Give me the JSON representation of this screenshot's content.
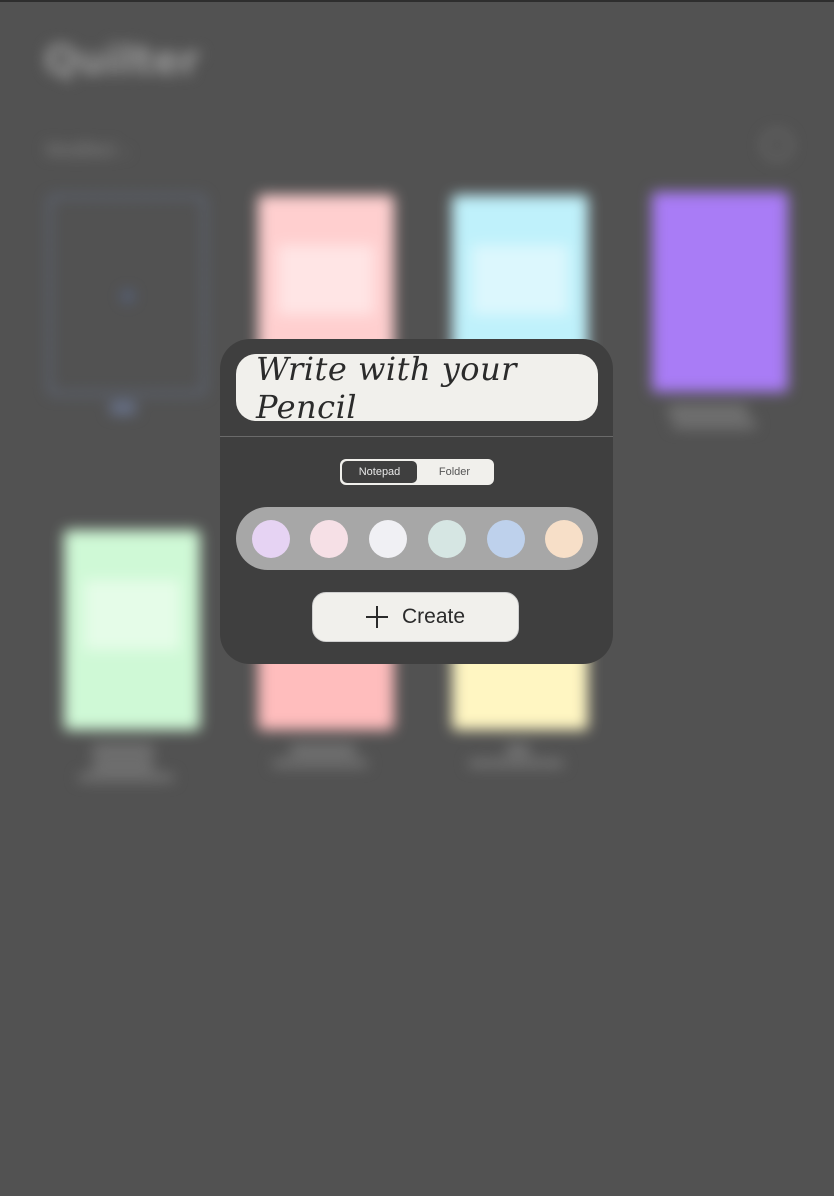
{
  "app": {
    "title": "Quilter",
    "sort_label": "Modified",
    "sort_chevron": "⌄"
  },
  "library": {
    "new_item_plus": "+",
    "cards": [
      {
        "color": "#ffcfcf"
      },
      {
        "color": "#bff1fb"
      },
      {
        "color": "#cff9d6"
      },
      {
        "color": "#ffbdbd"
      },
      {
        "color": "#fff6c2"
      }
    ],
    "folder_color": "#a97cf6"
  },
  "popover": {
    "title_value": "Write with your Pencil",
    "segments": [
      {
        "label": "Notepad",
        "selected": true
      },
      {
        "label": "Folder",
        "selected": false
      }
    ],
    "swatches": [
      "#e6d3f3",
      "#f6e0e6",
      "#f0f0f4",
      "#d6e6e3",
      "#bed1ec",
      "#f7dfc8"
    ],
    "create_label": "Create"
  },
  "colors": {
    "background": "#525252",
    "popover": "#3f3f3f",
    "field": "#f1f0ec"
  }
}
